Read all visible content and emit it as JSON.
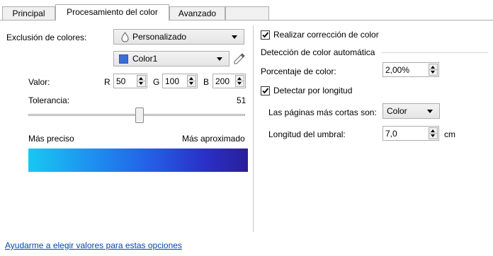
{
  "tabs": [
    {
      "label": "Principal",
      "active": false
    },
    {
      "label": "Procesamiento del color",
      "active": true
    },
    {
      "label": "Avanzado",
      "active": false
    }
  ],
  "left": {
    "exclusion_label": "Exclusión de colores:",
    "exclusion_value": "Personalizado",
    "color_value": "Color1",
    "color_swatch": "#3a6ed6",
    "valor_label": "Valor:",
    "r_label": "R",
    "r_value": "50",
    "g_label": "G",
    "g_value": "100",
    "b_label": "B",
    "b_value": "200",
    "tolerancia_label": "Tolerancia:",
    "tolerancia_value": "51",
    "slider_value": 51,
    "mas_preciso": "Más preciso",
    "mas_aproximado": "Más aproximado"
  },
  "right": {
    "realizar_label": "Realizar corrección de color",
    "realizar_checked": true,
    "group_title": "Detección de color automática",
    "porcentaje_label": "Porcentaje de color:",
    "porcentaje_value": "2,00%",
    "detectar_label": "Detectar por longitud",
    "detectar_checked": true,
    "paginas_label": "Las páginas más cortas son:",
    "paginas_value": "Color",
    "umbral_label": "Longitud del umbral:",
    "umbral_value": "7,0",
    "umbral_unit": "cm"
  },
  "help_link": "Ayudarme a elegir valores para estas opciones",
  "icons": {
    "drop": "drop-icon",
    "eyedropper": "eyedropper-icon",
    "check": "checkmark-icon"
  }
}
